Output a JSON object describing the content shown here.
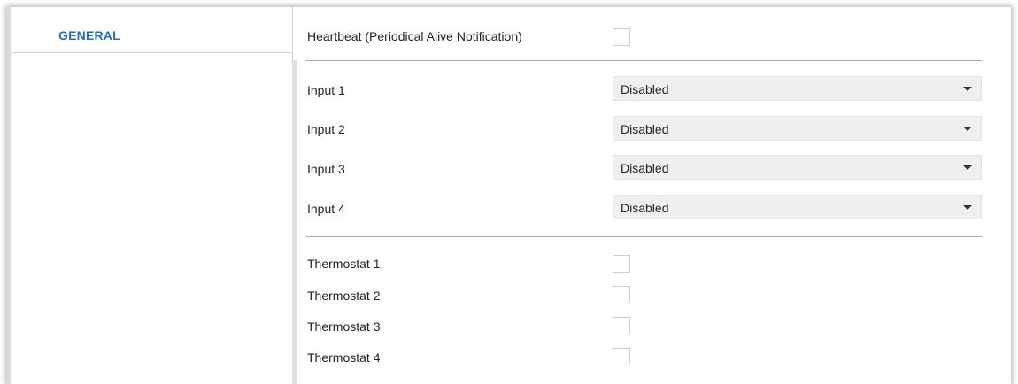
{
  "sidebar": {
    "items": [
      {
        "label": "GENERAL"
      }
    ]
  },
  "general": {
    "heartbeat_label": "Heartbeat (Periodical Alive Notification)",
    "heartbeat_checked": false,
    "inputs": [
      {
        "label": "Input 1",
        "value": "Disabled"
      },
      {
        "label": "Input 2",
        "value": "Disabled"
      },
      {
        "label": "Input 3",
        "value": "Disabled"
      },
      {
        "label": "Input 4",
        "value": "Disabled"
      }
    ],
    "thermostats": [
      {
        "label": "Thermostat 1",
        "checked": false
      },
      {
        "label": "Thermostat 2",
        "checked": false
      },
      {
        "label": "Thermostat 3",
        "checked": false
      },
      {
        "label": "Thermostat 4",
        "checked": false
      }
    ]
  },
  "colors": {
    "accent": "#2a6cb6",
    "select_bg": "#efefef"
  },
  "icons": {
    "dropdown": "dropdown-arrow-icon"
  }
}
